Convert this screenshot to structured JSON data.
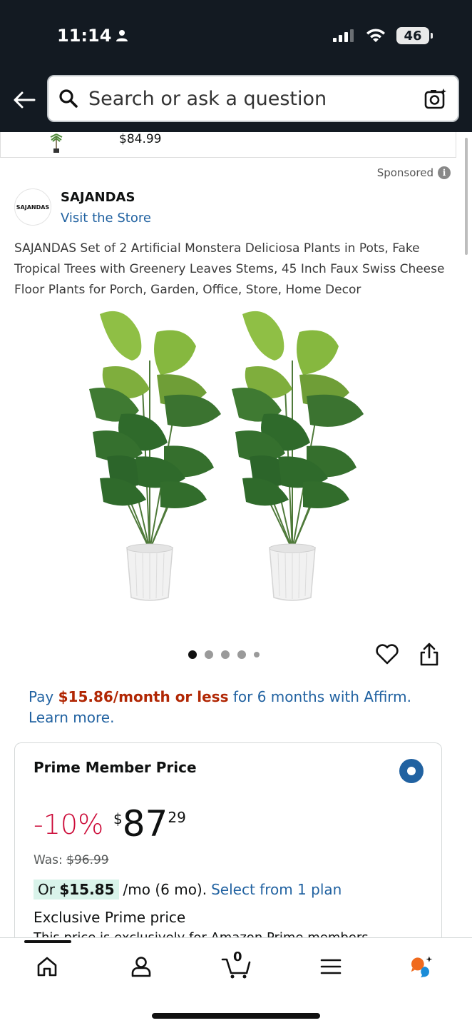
{
  "status_bar": {
    "time": "11:14",
    "battery": "46"
  },
  "header": {
    "search_placeholder": "Search or ask a question"
  },
  "previous_item": {
    "price": "$84.99"
  },
  "listing": {
    "sponsored_label": "Sponsored",
    "brand_logo_text": "SAJANDAS",
    "brand_name": "SAJANDAS",
    "visit_store": "Visit the Store",
    "title": "SAJANDAS Set of 2 Artificial Monstera Deliciosa Plants in Pots, Fake Tropical Trees with Greenery Leaves Stems, 45 Inch Faux Swiss Cheese Floor Plants for Porch, Garden, Office, Store, Home Decor",
    "image_count": 5,
    "active_image_index": 0
  },
  "affirm": {
    "prefix": "Pay ",
    "amount": "$15.86/month or less",
    "suffix": " for 6 months with Affirm.",
    "learn_more": "Learn more."
  },
  "price_card": {
    "title": "Prime Member Price",
    "discount": "-10%",
    "currency_symbol": "$",
    "price_whole": "87",
    "price_fraction": "29",
    "was_label": "Was: ",
    "was_price": "$96.99",
    "installment_prefix": "Or ",
    "installment_amount": "$15.85",
    "installment_suffix": "/mo (6 mo).",
    "installment_link": "Select from 1 plan",
    "exclusive": "Exclusive Prime price",
    "note": "This price is exclusively for Amazon Prime members"
  },
  "bottom_nav": {
    "cart_count": "0",
    "items": [
      "home-icon",
      "account-icon",
      "cart-icon",
      "menu-icon",
      "rufus-icon"
    ]
  },
  "colors": {
    "header_bg": "#131a22",
    "link": "#2162a1",
    "deal_red": "#cc0c39",
    "affirm_red": "#b12704",
    "installment_highlight": "#d9f3ea"
  }
}
